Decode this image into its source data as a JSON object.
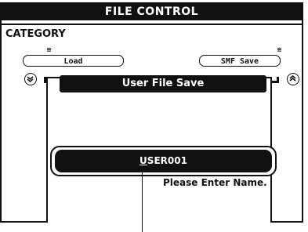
{
  "header": {
    "title": "FILE CONTROL"
  },
  "category": {
    "label": "CATEGORY"
  },
  "soft_buttons": {
    "load": "Load",
    "smf_save": "SMF Save"
  },
  "icons": {
    "left_nav": "down-arrow-circle-icon",
    "right_nav": "up-arrow-circle-icon"
  },
  "dialog": {
    "title": "User File Save",
    "name_first_char": "U",
    "name_rest": "SER001",
    "prompt": "Please Enter Name."
  }
}
